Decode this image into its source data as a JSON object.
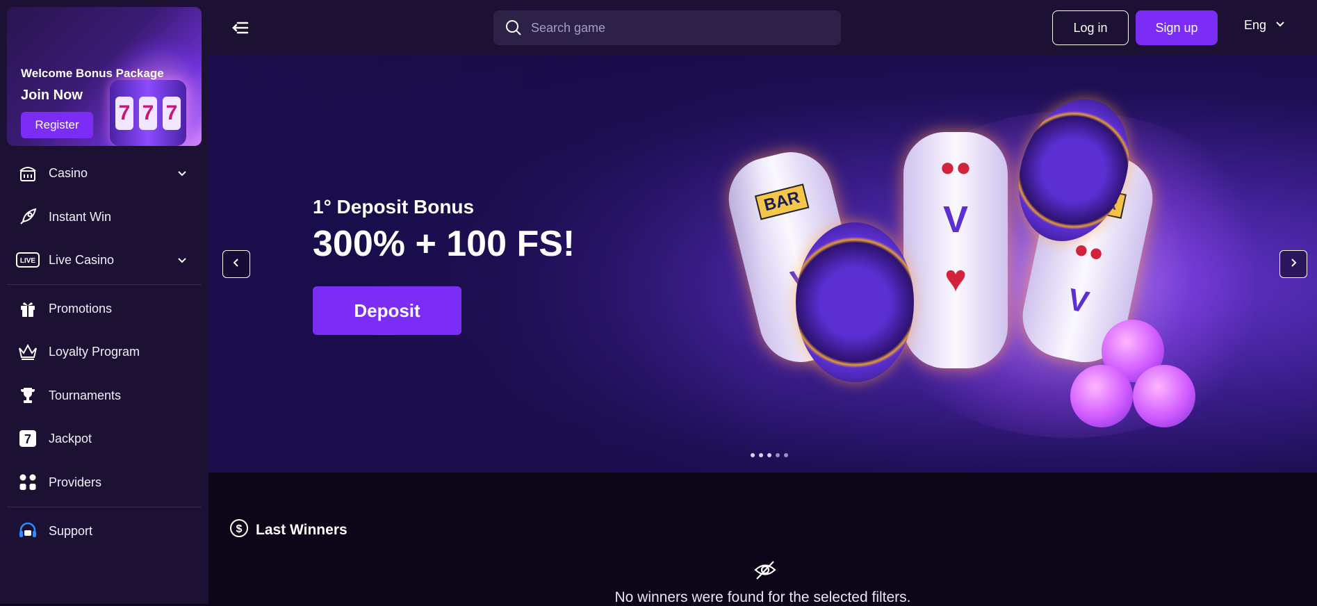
{
  "sidebar": {
    "promo": {
      "title": "Welcome Bonus Package",
      "subtitle": "Join Now",
      "register_label": "Register"
    },
    "items": [
      {
        "label": "Casino",
        "icon": "casino-icon",
        "has_submenu": true
      },
      {
        "label": "Instant Win",
        "icon": "rocket-icon",
        "has_submenu": false
      },
      {
        "label": "Live Casino",
        "icon": "live-icon",
        "has_submenu": true
      },
      {
        "label": "Promotions",
        "icon": "gift-icon",
        "has_submenu": false
      },
      {
        "label": "Loyalty Program",
        "icon": "crown-icon",
        "has_submenu": false
      },
      {
        "label": "Tournaments",
        "icon": "trophy-icon",
        "has_submenu": false
      },
      {
        "label": "Jackpot",
        "icon": "seven-icon",
        "has_submenu": false
      },
      {
        "label": "Providers",
        "icon": "grid-icon",
        "has_submenu": false
      },
      {
        "label": "Support",
        "icon": "headset-icon",
        "has_submenu": false
      }
    ]
  },
  "header": {
    "search_placeholder": "Search game",
    "login_label": "Log in",
    "signup_label": "Sign up",
    "language": "Eng"
  },
  "hero": {
    "title": "1° Deposit Bonus",
    "headline": "300% + 100 FS!",
    "cta_label": "Deposit",
    "slide_count": 5,
    "active_slide": 0
  },
  "winners": {
    "title": "Last Winners",
    "empty_message": "No winners were found for the selected filters."
  },
  "colors": {
    "accent": "#7b2cf5",
    "sidebar_bg": "#1c1132",
    "page_bg": "#0c0618"
  }
}
